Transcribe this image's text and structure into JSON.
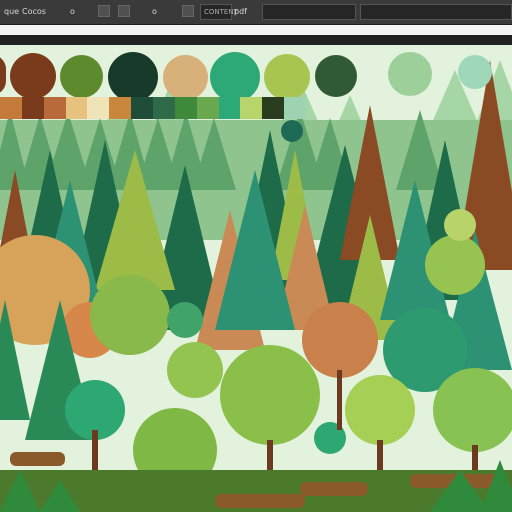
{
  "toolbar": {
    "items": [
      "que",
      "Cocos",
      "o",
      "o"
    ],
    "field_text": "CONTENT",
    "pdf_label": "pdf"
  },
  "palette": {
    "circles": [
      "#7a3b1c",
      "#5e8a2e",
      "#183a2a",
      "#d7b07a",
      "#2da877",
      "#a8c552",
      "#2f5a35",
      "#9ccf9a",
      "#9fd8b9"
    ],
    "bar": [
      "#c47a3b",
      "#7a3b1c",
      "#b86a3b",
      "#e6c27e",
      "#efe3b8",
      "#c8873c",
      "#1f4d3a",
      "#2f6b49",
      "#3e8a3a",
      "#6aa84f",
      "#2da877",
      "#b7d56a",
      "#2a3d1f",
      "#9dd3b0"
    ]
  },
  "colors": {
    "sky": "#dff2d8",
    "toolbar_bg": "#3a3a3a",
    "ground": "#4c7a2c"
  }
}
